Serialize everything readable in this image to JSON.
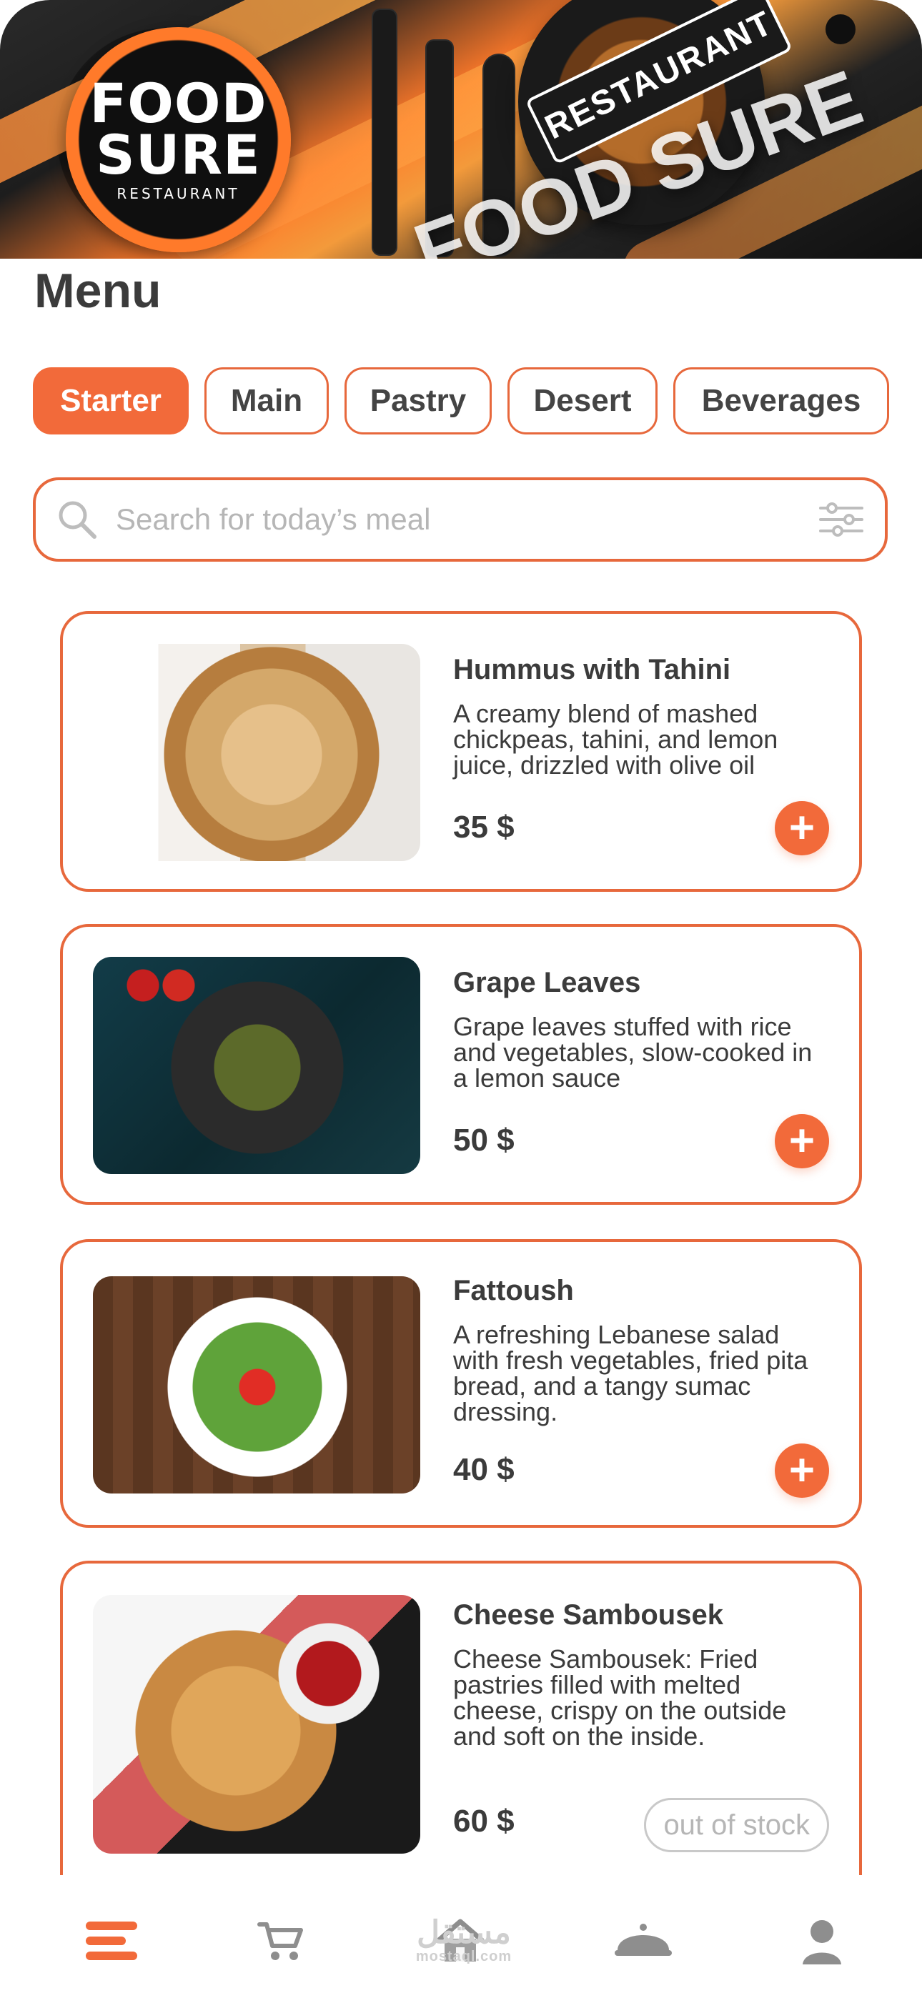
{
  "banner": {
    "logo_line1": "FOOD",
    "logo_line2": "SURE",
    "logo_sub": "RESTAURANT",
    "ribbon": "RESTAURANT",
    "brand_text": "FOOD SURE"
  },
  "page": {
    "title": "Menu"
  },
  "categories": [
    {
      "label": "Starter",
      "active": true
    },
    {
      "label": "Main",
      "active": false
    },
    {
      "label": "Pastry",
      "active": false
    },
    {
      "label": "Desert",
      "active": false
    },
    {
      "label": "Beverages",
      "active": false
    }
  ],
  "search": {
    "placeholder": "Search for today’s meal"
  },
  "menu": {
    "items": [
      {
        "title": "Hummus with Tahini",
        "description": " A creamy blend of mashed chickpeas, tahini, and lemon juice, drizzled with olive oil",
        "price": "35 $",
        "status": "available",
        "image": "hummus"
      },
      {
        "title": "Grape Leaves",
        "description": "Grape leaves stuffed with rice and vegetables, slow-cooked in a lemon sauce",
        "price": "50 $",
        "status": "available",
        "image": "grape-leaves"
      },
      {
        "title": "Fattoush",
        "description": "A refreshing Lebanese salad with fresh vegetables, fried pita bread, and a tangy sumac dressing.",
        "price": "40 $",
        "status": "available",
        "image": "fattoush"
      },
      {
        "title": "Cheese Sambousek",
        "description": "Cheese Sambousek: Fried pastries filled with melted cheese, crispy on the outside and soft on the inside.",
        "price": "60 $",
        "status": "out of stock",
        "image": "cheese-sambousek"
      }
    ]
  },
  "bottom_nav": [
    {
      "name": "menu",
      "icon": "menu-icon",
      "active": true
    },
    {
      "name": "cart",
      "icon": "cart-icon",
      "active": false
    },
    {
      "name": "home",
      "icon": "home-icon",
      "active": false
    },
    {
      "name": "dishes",
      "icon": "cloche-icon",
      "active": false
    },
    {
      "name": "profile",
      "icon": "user-icon",
      "active": false
    }
  ],
  "watermark": {
    "line1": "مستقل",
    "line2": "mostaql.com"
  },
  "colors": {
    "accent": "#F26A3A",
    "text": "#3A3A3A",
    "muted": "#9AA0A6"
  }
}
